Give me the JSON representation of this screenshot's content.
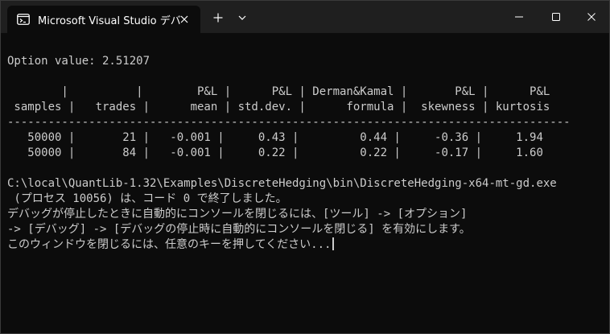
{
  "tab": {
    "title": "Microsoft Visual Studio デバッグ"
  },
  "titlebar_buttons": {
    "new_tab": "+",
    "dropdown": "⌄"
  },
  "console_lines": [
    "",
    "Option value: 2.51207",
    "",
    "        |          |        P&L |      P&L | Derman&Kamal |       P&L |      P&L",
    " samples |   trades |      mean | std.dev. |      formula |  skewness | kurtosis",
    "-----------------------------------------------------------------------------------",
    "   50000 |       21 |   -0.001 |     0.43 |         0.44 |     -0.36 |     1.94",
    "   50000 |       84 |   -0.001 |     0.22 |         0.22 |     -0.17 |     1.60",
    "",
    "C:\\local\\QuantLib-1.32\\Examples\\DiscreteHedging\\bin\\DiscreteHedging-x64-mt-gd.exe",
    " (プロセス 10056) は、コード 0 で終了しました。",
    "デバッグが停止したときに自動的にコンソールを閉じるには、[ツール] -> [オプション]",
    "-> [デバッグ] -> [デバッグの停止時に自動的にコンソールを閉じる] を有効にします。",
    "このウィンドウを閉じるには、任意のキーを押してください..."
  ],
  "colors": {
    "background": "#0c0c0c",
    "titlebar": "#1f1f1f",
    "text": "#cccccc"
  }
}
